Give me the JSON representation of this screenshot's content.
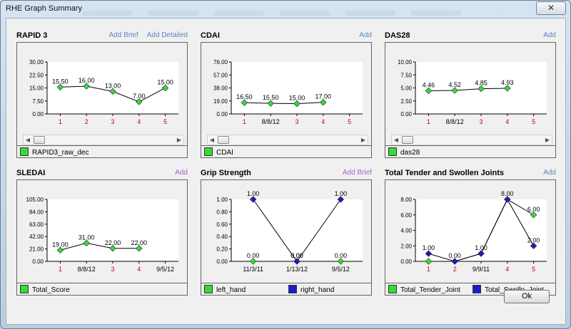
{
  "window": {
    "title": "RHE Graph Summary",
    "close_glyph": "✕",
    "ok_label": "Ok"
  },
  "panels": [
    {
      "title": "RAPID 3",
      "links": [
        {
          "label": "Add Brief",
          "color": "#5b85c0"
        },
        {
          "label": "Add Detailed",
          "color": "#5b85c0"
        }
      ],
      "legend": [
        {
          "label": "RAPID3_raw_dec",
          "color": "#33dd33"
        }
      ]
    },
    {
      "title": "CDAI",
      "links": [
        {
          "label": "Add",
          "color": "#5b85c0"
        }
      ],
      "legend": [
        {
          "label": "CDAI",
          "color": "#33dd33"
        }
      ]
    },
    {
      "title": "DAS28",
      "links": [
        {
          "label": "Add",
          "color": "#5b85c0"
        }
      ],
      "legend": [
        {
          "label": "das28",
          "color": "#33dd33"
        }
      ]
    },
    {
      "title": "SLEDAI",
      "links": [
        {
          "label": "Add",
          "color": "#a064c8"
        }
      ],
      "legend": [
        {
          "label": "Total_Score",
          "color": "#33dd33"
        }
      ]
    },
    {
      "title": "Grip Strength",
      "links": [
        {
          "label": "Add Brief",
          "color": "#a064c8"
        }
      ],
      "legend": [
        {
          "label": "left_hand",
          "color": "#33dd33"
        },
        {
          "label": "right_hand",
          "color": "#1a1acc"
        }
      ]
    },
    {
      "title": "Total Tender and Swollen Joints",
      "links": [
        {
          "label": "Add",
          "color": "#5b85c0"
        }
      ],
      "legend": [
        {
          "label": "Total_Tender_Joint",
          "color": "#33dd33"
        },
        {
          "label": "Total_Swolln_Joint",
          "color": "#1a1acc"
        }
      ]
    }
  ],
  "chart_data": [
    {
      "type": "line",
      "title": "RAPID 3",
      "yticks": [
        "30.00",
        "22.50",
        "15.00",
        "7.50",
        "0.00"
      ],
      "ylim": [
        0,
        30
      ],
      "x": [
        "1",
        "2",
        "3",
        "4",
        "5"
      ],
      "x_colors": [
        "#cc0000",
        "#cc0000",
        "#cc0000",
        "#cc0000",
        "#cc0000"
      ],
      "series": [
        {
          "name": "RAPID3_raw_dec",
          "color": "#33dd33",
          "values": [
            15.5,
            16,
            13,
            7,
            15
          ],
          "labels": [
            "15.50",
            "16.00",
            "13.00",
            "7.00",
            "15.00"
          ]
        }
      ]
    },
    {
      "type": "line",
      "title": "CDAI",
      "yticks": [
        "76.00",
        "57.00",
        "38.00",
        "19.00",
        "0.00"
      ],
      "ylim": [
        0,
        76
      ],
      "x": [
        "1",
        "8/8/12",
        "3",
        "4",
        "5"
      ],
      "x_colors": [
        "#cc0000",
        "#000000",
        "#cc0000",
        "#cc0000",
        "#cc0000"
      ],
      "series": [
        {
          "name": "CDAI",
          "color": "#33dd33",
          "values": [
            16.5,
            15.5,
            15,
            17,
            null
          ],
          "labels": [
            "16.50",
            "15.50",
            "15.00",
            "17.00",
            ""
          ]
        }
      ]
    },
    {
      "type": "line",
      "title": "DAS28",
      "yticks": [
        "10.00",
        "7.50",
        "5.00",
        "2.50",
        "0.00"
      ],
      "ylim": [
        0,
        10
      ],
      "x": [
        "1",
        "8/8/12",
        "3",
        "4",
        "5"
      ],
      "x_colors": [
        "#cc0000",
        "#000000",
        "#cc0000",
        "#cc0000",
        "#cc0000"
      ],
      "series": [
        {
          "name": "das28",
          "color": "#33dd33",
          "values": [
            4.46,
            4.52,
            4.85,
            4.93,
            null
          ],
          "labels": [
            "4.46",
            "4.52",
            "4.85",
            "4.93",
            ""
          ]
        }
      ]
    },
    {
      "type": "line",
      "title": "SLEDAI",
      "yticks": [
        "105.00",
        "84.00",
        "63.00",
        "42.00",
        "21.00",
        "0.00"
      ],
      "ylim": [
        0,
        105
      ],
      "x": [
        "1",
        "8/8/12",
        "3",
        "4",
        "9/5/12"
      ],
      "x_colors": [
        "#cc0000",
        "#000000",
        "#cc0000",
        "#cc0000",
        "#000000"
      ],
      "series": [
        {
          "name": "Total_Score",
          "color": "#33dd33",
          "values": [
            19,
            31,
            22,
            22,
            null
          ],
          "labels": [
            "19.00",
            "31.00",
            "22.00",
            "22.00",
            ""
          ]
        }
      ]
    },
    {
      "type": "line",
      "title": "Grip Strength",
      "yticks": [
        "1.00",
        "0.80",
        "0.60",
        "0.40",
        "0.20",
        "0.00"
      ],
      "ylim": [
        0,
        1
      ],
      "x": [
        "11/3/11",
        "1/13/12",
        "9/5/12"
      ],
      "x_colors": [
        "#000000",
        "#000000",
        "#000000"
      ],
      "series": [
        {
          "name": "left_hand",
          "color": "#33dd33",
          "values": [
            0,
            0,
            0
          ],
          "labels": [
            "0.00",
            "0.00",
            "0.00"
          ]
        },
        {
          "name": "right_hand",
          "color": "#1a1acc",
          "values": [
            1,
            0,
            1
          ],
          "labels": [
            "1.00",
            "0.00",
            "1.00"
          ]
        }
      ]
    },
    {
      "type": "line",
      "title": "Total Tender and Swollen Joints",
      "yticks": [
        "8.00",
        "6.00",
        "4.00",
        "2.00",
        "0.00"
      ],
      "ylim": [
        0,
        8
      ],
      "x": [
        "1",
        "2",
        "9/9/11",
        "4",
        "5"
      ],
      "x_colors": [
        "#cc0000",
        "#cc0000",
        "#000000",
        "#cc0000",
        "#cc0000"
      ],
      "series": [
        {
          "name": "Total_Tender_Joint",
          "color": "#33dd33",
          "values": [
            0,
            0,
            1,
            8,
            6
          ],
          "labels": [
            "",
            "",
            "",
            "",
            "6.00"
          ]
        },
        {
          "name": "Total_Swolln_Joint",
          "color": "#1a1acc",
          "values": [
            1,
            0,
            1,
            8,
            2
          ],
          "labels": [
            "1.00",
            "0.00",
            "1.00",
            "8.00",
            "2.00"
          ]
        }
      ]
    }
  ]
}
